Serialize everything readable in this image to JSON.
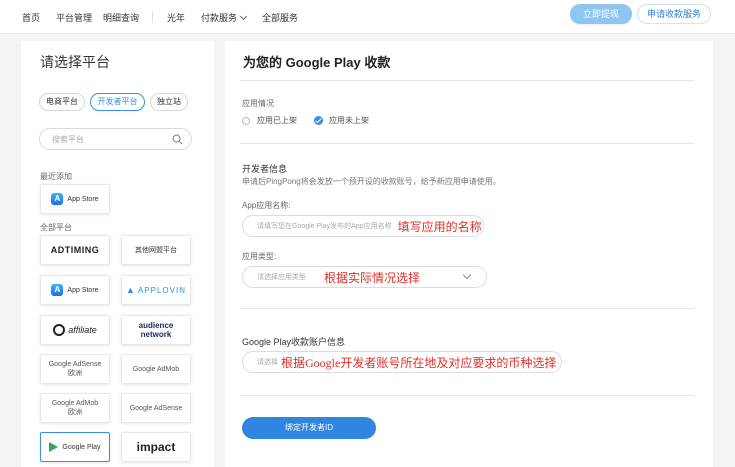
{
  "nav": {
    "items": [
      "首页",
      "平台管理",
      "明细查询",
      "光年",
      "付款服务",
      "全部服务"
    ],
    "withdraw_label": "立即提现",
    "apply_label": "申请收款服务"
  },
  "sidebar": {
    "title": "请选择平台",
    "tabs": [
      "电商平台",
      "开发者平台",
      "独立站"
    ],
    "search_placeholder": "搜索平台",
    "recent_label": "最近添加",
    "recent": [
      "App Store"
    ],
    "all_label": "全部平台",
    "platforms": {
      "adtiming": "ADTIMING",
      "other": "其他网盟平台",
      "appstore": "App Store",
      "applovin": "APPLOVIN",
      "affiliate": "affiliate",
      "audience_1": "audience",
      "audience_2": "network",
      "adsense_eu_1": "Google AdSense",
      "adsense_eu_2": "欧洲",
      "admob": "Google AdMob",
      "admob_eu_1": "Google AdMob",
      "admob_eu_2": "欧洲",
      "adsense": "Google AdSense",
      "googleplay": "Google Play",
      "impact": "impact"
    }
  },
  "form": {
    "title": "为您的 Google Play 收款",
    "app_status_label": "应用情况",
    "option_listed": "应用已上架",
    "option_unlisted": "应用未上架",
    "dev_info_head": "开发者信息",
    "dev_info_hint": "申请后PingPong将会发放一个预开设的收款账号，给予新应用申请使用。",
    "app_name_label": "App应用名称:",
    "app_name_placeholder": "请填写您在Google Play发布的App应用名称",
    "app_name_annot": "填写应用的名称",
    "app_type_label": "应用类型:",
    "app_type_placeholder": "请选择应用类型",
    "app_type_annot": "根据实际情况选择",
    "account_head": "Google Play收款账户信息",
    "account_placeholder": "请选择",
    "account_annot": "根据Google开发者账号所在地及对应要求的币种选择",
    "submit_label": "绑定开发者ID"
  }
}
